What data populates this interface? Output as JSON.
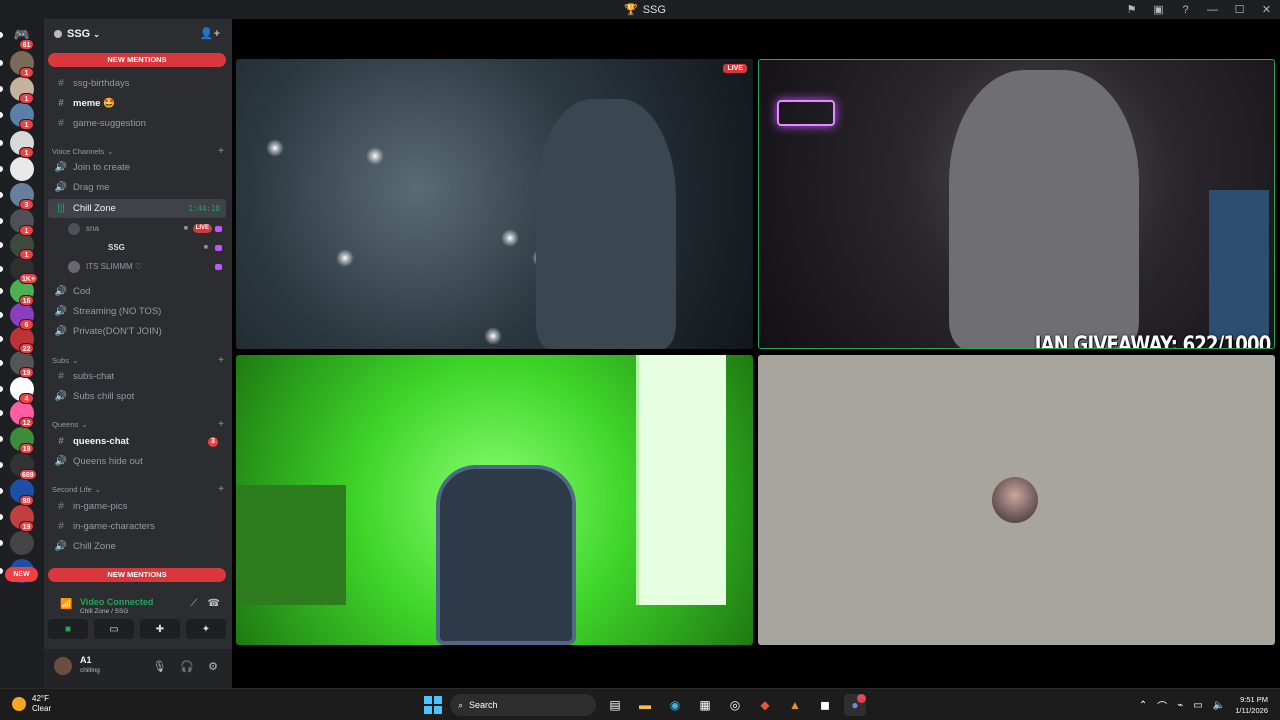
{
  "window": {
    "title": "SSG"
  },
  "server": {
    "name": "SSG"
  },
  "rail": {
    "badges": [
      "61",
      "1",
      "1",
      "1",
      "1",
      "3",
      "1",
      "1",
      "1K+",
      "16",
      "6",
      "22",
      "19",
      "4",
      "12",
      "19",
      "689",
      "88",
      "19"
    ],
    "new_label": "NEW"
  },
  "sidebar": {
    "new_mentions_top": "NEW MENTIONS",
    "new_mentions_bottom": "NEW MENTIONS",
    "channels_top": [
      {
        "icon": "#",
        "name": "ssg-birthdays"
      },
      {
        "icon": "#",
        "name": "meme 🤩"
      },
      {
        "icon": "#",
        "name": "game-suggestion"
      }
    ],
    "voice_category": "Voice Channels",
    "voice_channels": [
      {
        "icon": "🔊",
        "name": "Join to create"
      },
      {
        "icon": "🔊",
        "name": "Drag me"
      }
    ],
    "active_voice": {
      "name": "Chill Zone",
      "timer": "1:44:18"
    },
    "voice_users": [
      {
        "name": "sna",
        "live": "LIVE"
      },
      {
        "name": "SSG"
      },
      {
        "name": "ITS SLIMMM ♡"
      }
    ],
    "voice_channels_2": [
      {
        "icon": "🔊",
        "name": "Cod"
      },
      {
        "icon": "🔊",
        "name": "Streaming (NO TOS)"
      },
      {
        "icon": "🔊",
        "name": "Private(DON'T JOIN)"
      }
    ],
    "subs_category": "Subs",
    "subs_channels": [
      {
        "icon": "#",
        "name": "subs-chat"
      },
      {
        "icon": "🔊",
        "name": "Subs chill spot"
      }
    ],
    "queens_category": "Queens",
    "queens_chat": {
      "name": "queens-chat",
      "count": "3"
    },
    "queens_hide": "Queens hide out",
    "second_life_category": "Second Life",
    "second_life_channels": [
      {
        "icon": "#",
        "name": "in-game-pics"
      },
      {
        "icon": "#",
        "name": "in-game-characters"
      },
      {
        "icon": "🔊",
        "name": "Chill Zone"
      }
    ]
  },
  "voice_panel": {
    "status": "Video Connected",
    "location": "Chill Zone / SSG"
  },
  "user": {
    "name": "A1",
    "status": "chilling"
  },
  "stage": {
    "live_label": "LIVE",
    "overlay_text": "JAN GIVEAWAY: 622/1000"
  },
  "taskbar": {
    "temperature": "42°F",
    "condition": "Clear",
    "search_label": "Search",
    "discord_badge": "9+",
    "time": "9:51 PM",
    "date": "1/11/2026"
  },
  "colors": {
    "accent_green": "#23a55a",
    "mention_red": "#da373c",
    "sidebar_bg": "#2b2d31",
    "rail_bg": "#1e1f22"
  }
}
